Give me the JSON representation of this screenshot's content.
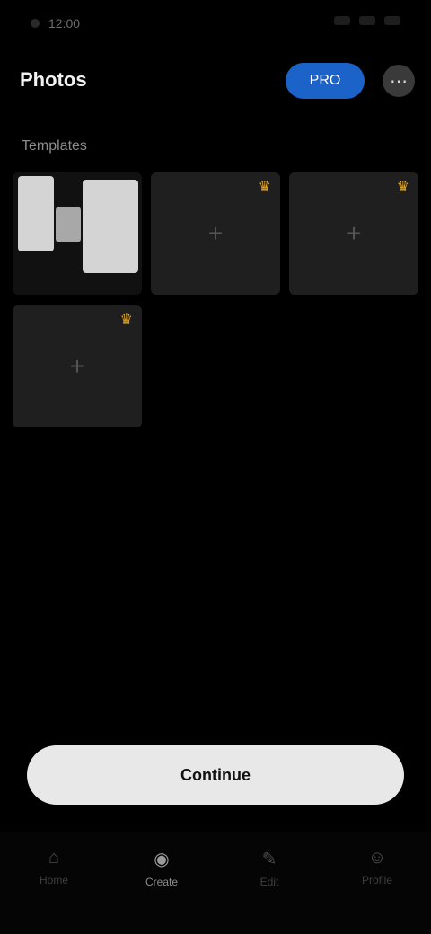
{
  "status": {
    "time": "12:00"
  },
  "header": {
    "title": "Photos",
    "pro_label": "PRO",
    "more_icon": "more-icon"
  },
  "section": {
    "label": "Templates"
  },
  "cards": [
    {
      "type": "photo",
      "crown": ""
    },
    {
      "type": "empty",
      "crown": "♛",
      "plus": "+"
    },
    {
      "type": "empty",
      "crown": "♛",
      "plus": "+"
    },
    {
      "type": "empty",
      "crown": "♛",
      "plus": "+"
    }
  ],
  "cta": {
    "label": "Continue"
  },
  "nav": [
    {
      "label": "Home",
      "icon": "⌂"
    },
    {
      "label": "Create",
      "icon": "◉"
    },
    {
      "label": "Edit",
      "icon": "✎"
    },
    {
      "label": "Profile",
      "icon": "☺"
    }
  ],
  "colors": {
    "accent": "#1b62c9",
    "crown": "#e2a72b",
    "background": "#000000"
  }
}
